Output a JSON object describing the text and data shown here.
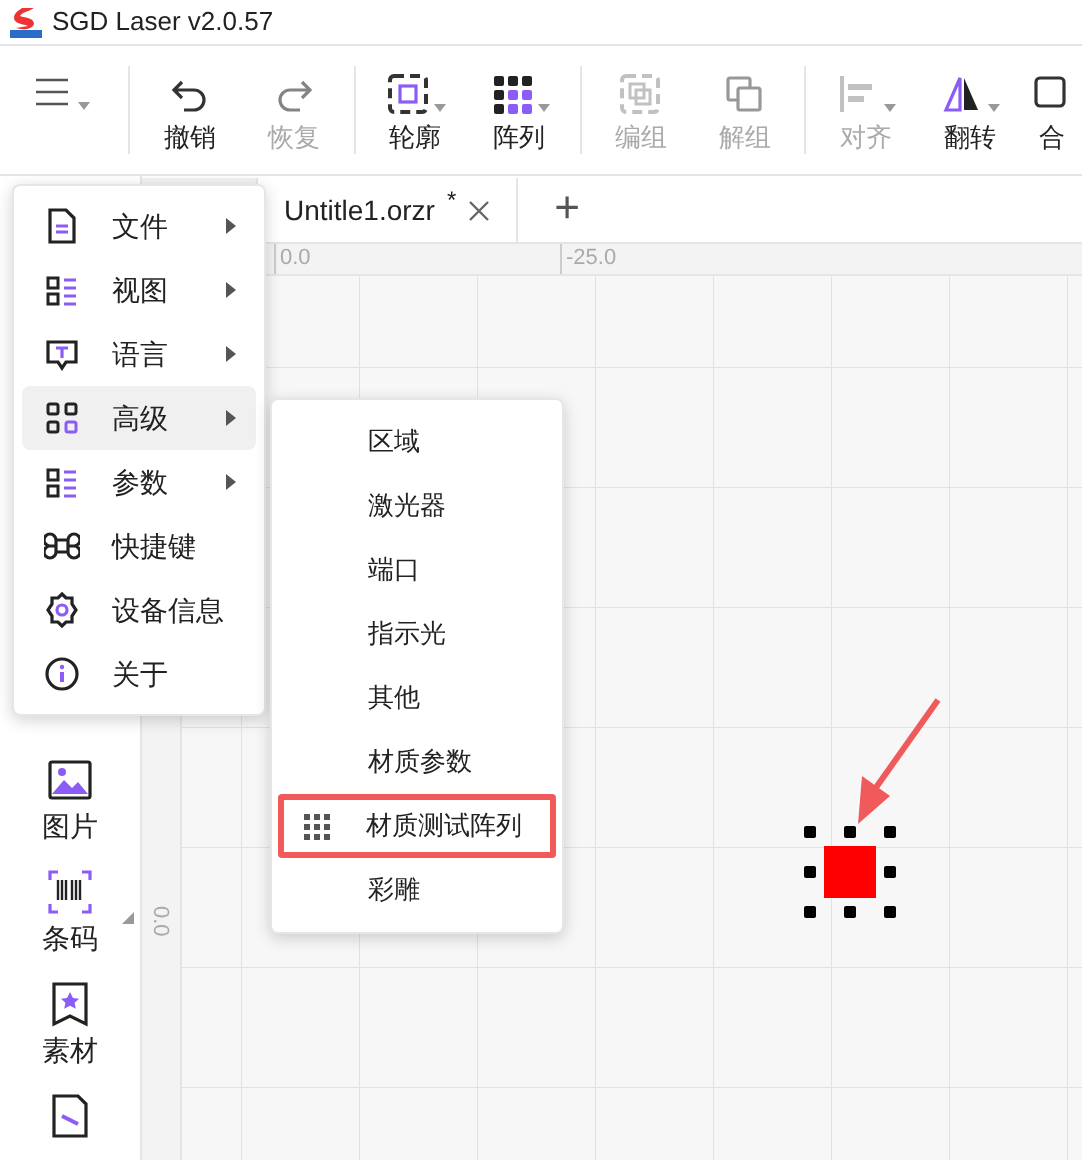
{
  "window": {
    "title": "SGD Laser v2.0.57"
  },
  "toolbar": {
    "groups": [
      [
        {
          "dropdown": true,
          "disabled": false
        }
      ],
      [
        {
          "label": "撤销",
          "dropdown": false,
          "disabled": false
        },
        {
          "label": "恢复",
          "dropdown": false,
          "disabled": true
        }
      ],
      [
        {
          "label": "轮廓",
          "dropdown": true,
          "disabled": false
        },
        {
          "label": "阵列",
          "dropdown": true,
          "disabled": false
        }
      ],
      [
        {
          "label": "编组",
          "dropdown": false,
          "disabled": true
        },
        {
          "label": "解组",
          "dropdown": false,
          "disabled": true
        }
      ],
      [
        {
          "label": "对齐",
          "dropdown": true,
          "disabled": true
        },
        {
          "label": "翻转",
          "dropdown": true,
          "disabled": false
        },
        {
          "label": "合",
          "dropdown": false,
          "disabled": false
        }
      ]
    ]
  },
  "tabs": [
    {
      "selected": false
    },
    {
      "label": "Untitle1.orzr",
      "modified": "*",
      "selected": true
    }
  ],
  "new_tab": "+",
  "ruler": {
    "top_labels": [
      "0.0",
      "-25.0"
    ],
    "left_labels": [
      "0.0"
    ]
  },
  "left_tools": [
    {
      "label": "图片",
      "dropdown": false
    },
    {
      "label": "条码",
      "dropdown": true
    },
    {
      "label": "素材",
      "dropdown": false
    },
    {
      "dropdown": false
    }
  ],
  "menu": {
    "items": [
      {
        "label": "文件",
        "submenu": true,
        "selected": false
      },
      {
        "label": "视图",
        "submenu": true,
        "selected": false
      },
      {
        "label": "语言",
        "submenu": true,
        "selected": false
      },
      {
        "label": "高级",
        "submenu": true,
        "selected": true
      },
      {
        "label": "参数",
        "submenu": true,
        "selected": false
      },
      {
        "label": "快捷键",
        "submenu": false,
        "selected": false
      },
      {
        "label": "设备信息",
        "submenu": false,
        "selected": false
      },
      {
        "label": "关于",
        "submenu": false,
        "selected": false
      }
    ]
  },
  "submenu": {
    "items": [
      {
        "label": "区域",
        "highlighted": false
      },
      {
        "label": "激光器",
        "highlighted": false
      },
      {
        "label": "端口",
        "highlighted": false
      },
      {
        "label": "指示光",
        "highlighted": false
      },
      {
        "label": "其他",
        "highlighted": false
      },
      {
        "label": "材质参数",
        "highlighted": false
      },
      {
        "label": "材质测试阵列",
        "highlighted": true
      },
      {
        "label": "彩雕",
        "highlighted": false
      }
    ]
  },
  "canvas": {
    "object": {
      "color": "#ff0000",
      "selected": true
    },
    "pointer_arrow": true
  }
}
